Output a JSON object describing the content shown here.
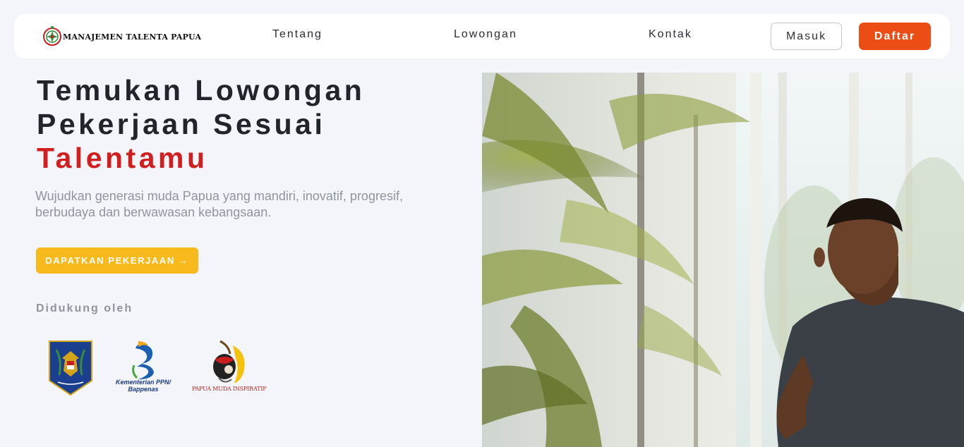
{
  "nav": {
    "logo_text": "MANAJEMEN TALENTA PAPUA",
    "links": [
      "Tentang",
      "Lowongan",
      "Kontak"
    ],
    "login_label": "Masuk",
    "register_label": "Daftar"
  },
  "hero": {
    "title_line1": "Temukan Lowongan",
    "title_line2": "Pekerjaan Sesuai",
    "title_accent": "Talentamu",
    "subtitle": "Wujudkan generasi muda Papua yang mandiri, inovatif, progresif, berbudaya dan berwawasan kebangsaan.",
    "cta_label": "DAPATKAN PEKERJAAN →",
    "supported_by": "Didukung oleh"
  },
  "partners": {
    "bappenas_line1": "Kementerian PPN/",
    "bappenas_line2": "Bappenas",
    "papua_muda": "PAPUA MUDA INSPIRATIF"
  },
  "colors": {
    "accent_red": "#d11f1f",
    "register_orange": "#ec4d14",
    "cta_yellow": "#f8b91c",
    "page_bg": "#f3f5fa"
  },
  "icons": {
    "logo": "papua-emblem-icon",
    "cta_arrow": "arrow-right-icon"
  }
}
